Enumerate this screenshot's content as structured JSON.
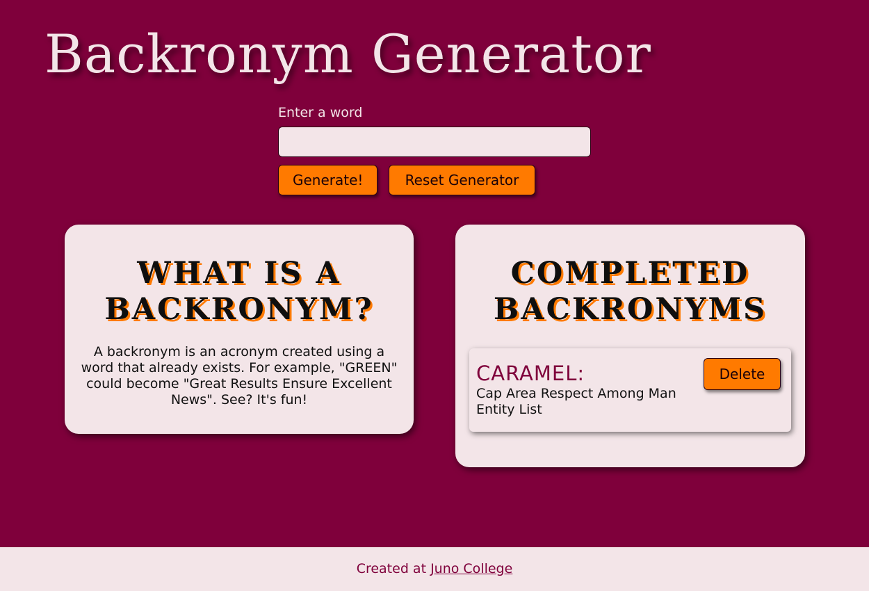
{
  "header": {
    "title": "Backronym Generator"
  },
  "form": {
    "label": "Enter a word",
    "input_value": "",
    "generate_label": "Generate!",
    "reset_label": "Reset Generator"
  },
  "info_card": {
    "heading": "What is a Backronym?",
    "text": "A backronym is an acronym created using a word that already exists. For example, \"GREEN\" could become \"Great Results Ensure Excellent News\". See? It's fun!"
  },
  "completed_card": {
    "heading": "Completed Backronyms",
    "items": [
      {
        "word": "CARAMEL:",
        "phrase": "Cap Area Respect Among Man Entity List",
        "delete_label": "Delete"
      }
    ]
  },
  "footer": {
    "prefix": "Created at",
    "link_text": "Juno College"
  },
  "colors": {
    "background": "#7f003b",
    "card": "#f3e5e8",
    "accent": "#ff7a00"
  }
}
